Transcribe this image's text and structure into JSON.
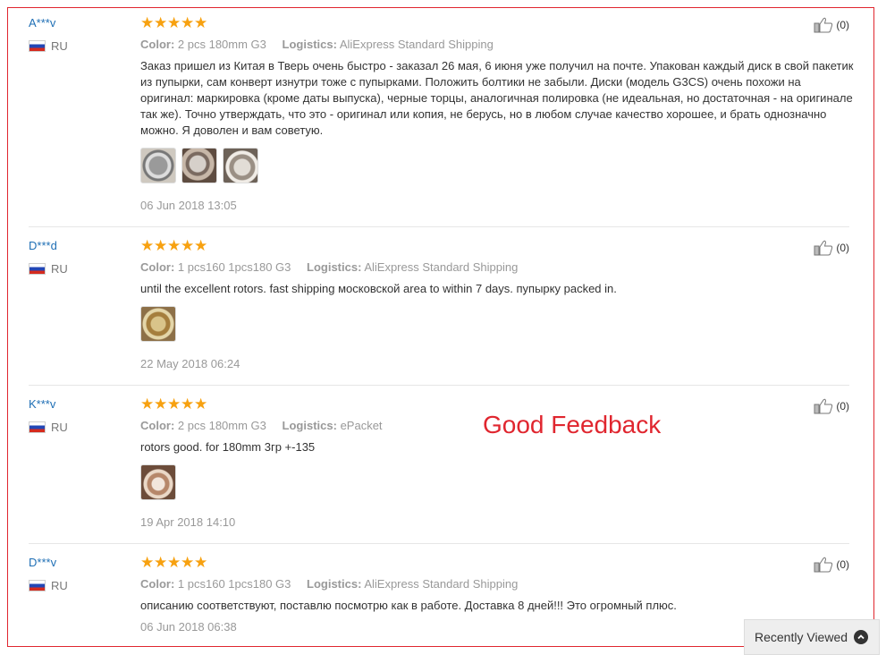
{
  "annotation": "Good Feedback",
  "recently_viewed": {
    "label": "Recently Viewed"
  },
  "labels": {
    "color": "Color:",
    "logistics": "Logistics:"
  },
  "reviews": [
    {
      "user": "A***v",
      "country": "RU",
      "rating": 5,
      "color": "2 pcs 180mm G3",
      "logistics": "AliExpress Standard Shipping",
      "text": "Заказ пришел из Китая в Тверь очень быстро - заказал 26 мая, 6 июня уже получил на почте. Упакован каждый диск в свой пакетик из пупырки, сам конверт изнутри тоже с пупырками. Положить болтики не забыли. Диски (модель G3CS) очень похожи на оригинал: маркировка (кроме даты выпуска), черные торцы, аналогичная полировка (не идеальная, но достаточная - на оригинале так же). Точно утверждать, что это - оригинал или копия, не берусь, но в любом случае качество хорошее, и брать однозначно можно. Я доволен и вам советую.",
      "photos": 3,
      "date": "06 Jun 2018 13:05",
      "helpful": "(0)"
    },
    {
      "user": "D***d",
      "country": "RU",
      "rating": 5,
      "color": "1 pcs160 1pcs180 G3",
      "logistics": "AliExpress Standard Shipping",
      "text": "until the excellent rotors. fast shipping московской area to within 7 days. пупырку packed in.",
      "photos": 1,
      "date": "22 May 2018 06:24",
      "helpful": "(0)"
    },
    {
      "user": "K***v",
      "country": "RU",
      "rating": 5,
      "color": "2 pcs 180mm G3",
      "logistics": "ePacket",
      "text": "rotors good. for 180mm 3гр +-135",
      "photos": 1,
      "date": "19 Apr 2018 14:10",
      "helpful": "(0)"
    },
    {
      "user": "D***v",
      "country": "RU",
      "rating": 5,
      "color": "1 pcs160 1pcs180 G3",
      "logistics": "AliExpress Standard Shipping",
      "text": "описанию соответствуют, поставлю посмотрю как в работе. Доставка 8 дней!!! Это огромный плюс.",
      "photos": 0,
      "date": "06 Jun 2018 06:38",
      "helpful": "(0)"
    }
  ],
  "colors": {
    "star": "#f7a110",
    "user": "#1f6fb5",
    "annotation": "#e0262f"
  },
  "icons": {
    "helpful": "thumbs-up-icon",
    "flag": "russia-flag-icon",
    "chevron": "chevron-up-icon"
  }
}
